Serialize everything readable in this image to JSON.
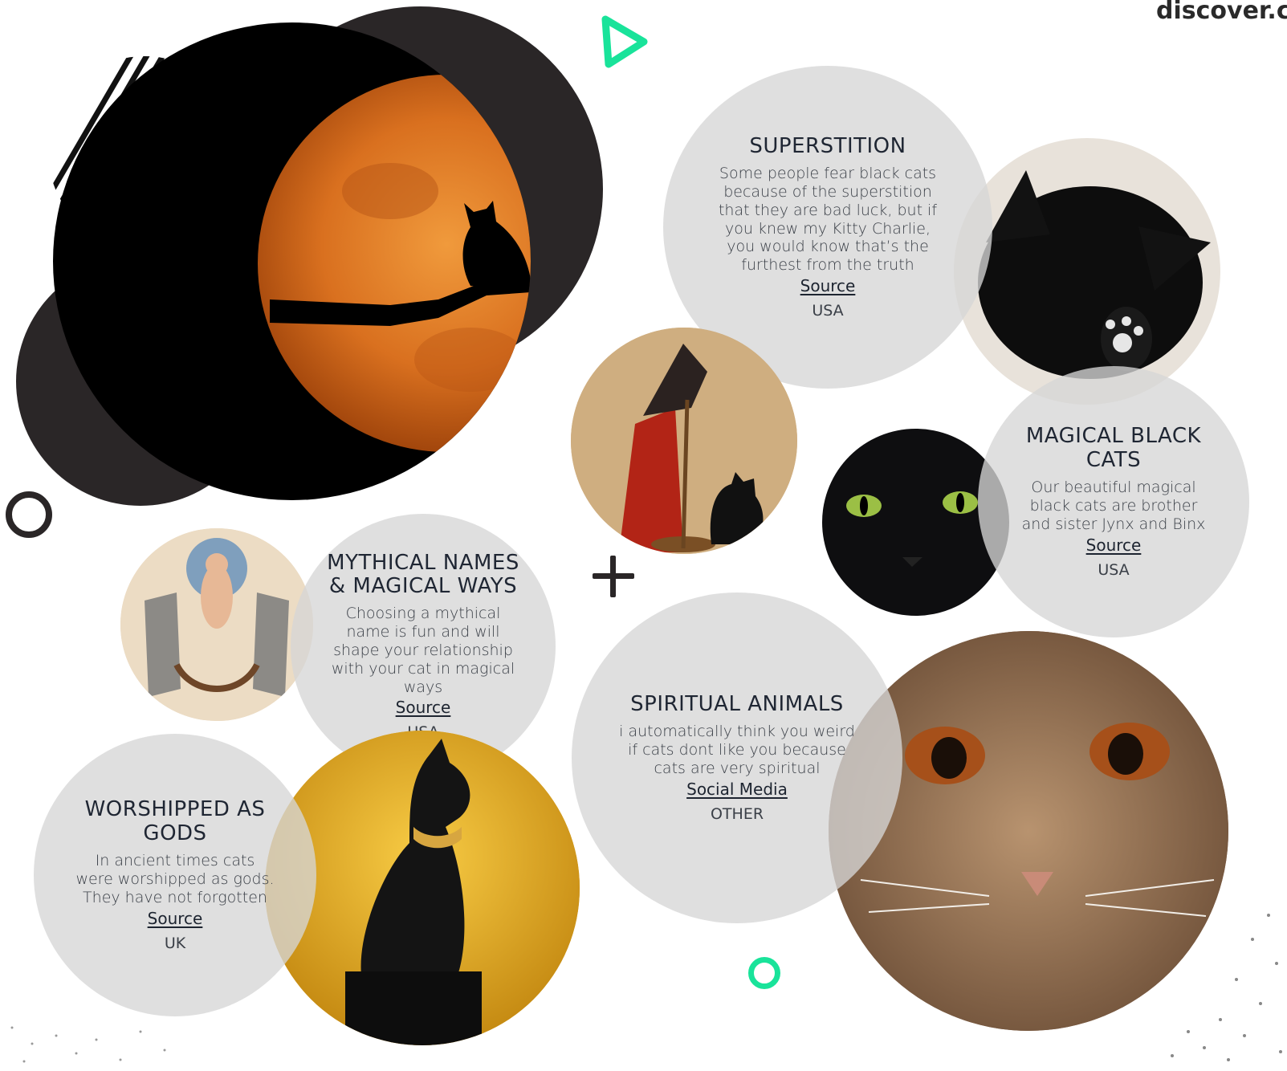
{
  "brand": {
    "text": "discover.c"
  },
  "cards": [
    {
      "title": "SUPERSTITION",
      "text": "Some people fear black cats because of the superstition that they are bad luck, but if you knew my Kitty Charlie, you would know that’s the furthest from the truth",
      "link": "Source",
      "country": "USA"
    },
    {
      "title": "MAGICAL BLACK CATS",
      "text": "Our beautiful magical black cats are brother and sister Jynx and Binx",
      "link": "Source",
      "country": "USA"
    },
    {
      "title": "MYTHICAL NAMES & MAGICAL WAYS",
      "text": "Choosing a mythical name is fun and will shape your relationship with your cat in magical ways",
      "link": "Source",
      "country": "USA"
    },
    {
      "title": "SPIRITUAL ANIMALS",
      "text": "i automatically think you weird if cats dont like you because cats are very spiritual",
      "link": "Social Media",
      "country": "OTHER"
    },
    {
      "title": "WORSHIPPED AS GODS",
      "text": "In ancient times cats were worshipped as gods. They have not forgotten",
      "link": "Source",
      "country": "UK"
    }
  ],
  "images": {
    "moon_cat": "cat silhouette on branch against orange moon",
    "kitten": "black kitten sleeping",
    "witch": "witch with broom and black cat",
    "black_cat_face": "black cat with green eyes",
    "goddess": "goddess Freya with cats",
    "bastet": "black Bastet cat statue on gold background",
    "tabby": "tabby cat face close-up"
  },
  "colors": {
    "accent_green": "#19e39a",
    "dark": "#2a2627",
    "bubble": "#d9d9d9"
  }
}
